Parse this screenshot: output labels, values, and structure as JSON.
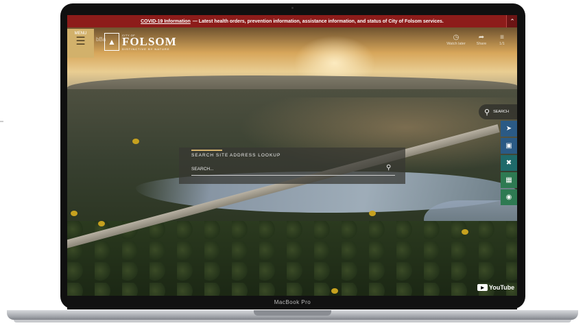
{
  "device": {
    "label": "MacBook Pro"
  },
  "banner": {
    "link_text": "COVID-19 Information",
    "text": "— Latest health orders, prevention information, assistance information, and status of City of Folsom services.",
    "collapse_icon": "double-chevron-up-icon"
  },
  "header": {
    "menu_label": "MENU",
    "menu_icon": "hamburger-icon",
    "ghost_text": "bBa",
    "logo": {
      "city_of": "CITY OF",
      "name": "FOLSOM",
      "tagline": "DISTINCTIVE BY NATURE"
    }
  },
  "video_controls": [
    {
      "label": "Watch later",
      "icon": "clock-icon"
    },
    {
      "label": "Share",
      "icon": "share-icon"
    },
    {
      "label": "1/1",
      "icon": "playlist-icon"
    }
  ],
  "search_panel": {
    "tabs": [
      "SEARCH SITE",
      "ADDRESS LOOKUP"
    ],
    "placeholder": "SEARCH...",
    "submit_icon": "search-icon"
  },
  "side_search": {
    "label": "SEARCH"
  },
  "quick_links": [
    {
      "icon": "cursor-icon",
      "color": "#2b5a85"
    },
    {
      "icon": "newspaper-icon",
      "color": "#2b5a85"
    },
    {
      "icon": "tools-icon",
      "color": "#1f6a6a"
    },
    {
      "icon": "calendar-icon",
      "color": "#2e7a52"
    },
    {
      "icon": "payment-icon",
      "color": "#2e7a52"
    }
  ],
  "youtube": {
    "label": "YouTube"
  }
}
